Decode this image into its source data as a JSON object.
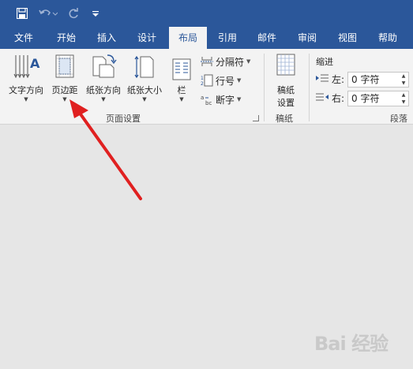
{
  "quick_access": {
    "save_icon": "save-icon",
    "undo_icon": "undo-icon",
    "redo_icon": "redo-icon",
    "customize_icon": "customize-qat-icon"
  },
  "tabs": [
    {
      "label": "文件"
    },
    {
      "label": "开始"
    },
    {
      "label": "插入"
    },
    {
      "label": "设计"
    },
    {
      "label": "布局"
    },
    {
      "label": "引用"
    },
    {
      "label": "邮件"
    },
    {
      "label": "审阅"
    },
    {
      "label": "视图"
    },
    {
      "label": "帮助"
    }
  ],
  "active_tab": "布局",
  "ribbon": {
    "text_direction": "文字方向",
    "margins": "页边距",
    "orientation": "纸张方向",
    "size": "纸张大小",
    "columns": "栏",
    "breaks": "分隔符",
    "line_numbers": "行号",
    "hyphenation": "断字",
    "page_setup_group": "页面设置",
    "draft_paper_line1": "稿纸",
    "draft_paper_line2": "设置",
    "draft_paper_group": "稿纸",
    "indent_title": "缩进",
    "indent_left_label": "左:",
    "indent_left_value": "0 字符",
    "indent_right_label": "右:",
    "indent_right_value": "0 字符",
    "paragraph_group": "段落"
  },
  "watermark": "Bai 经验",
  "colors": {
    "title_bar": "#2b579a",
    "ribbon_bg": "#f3f3f3",
    "canvas_bg": "#e6e6e6",
    "annotation_arrow": "#e02020"
  }
}
